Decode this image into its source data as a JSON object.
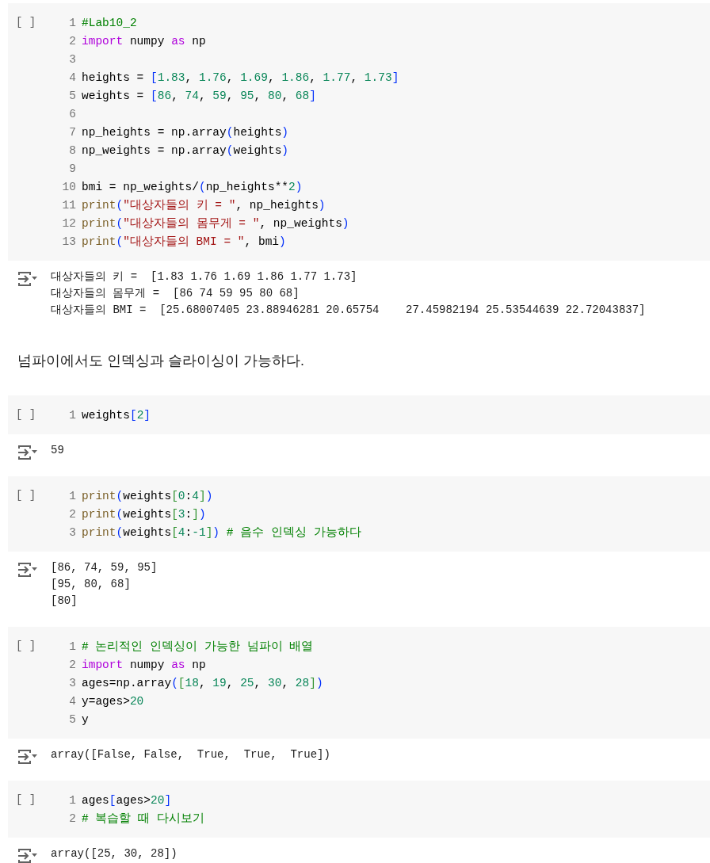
{
  "cells": [
    {
      "kind": "code",
      "run_marker": "[ ]",
      "lines": [
        {
          "number": "1",
          "tokens": [
            {
              "kind": "comment",
              "text": "#Lab10_2"
            }
          ]
        },
        {
          "number": "2",
          "tokens": [
            {
              "kind": "keyword",
              "text": "import"
            },
            {
              "kind": "plain",
              "text": " numpy "
            },
            {
              "kind": "keyword",
              "text": "as"
            },
            {
              "kind": "plain",
              "text": " np"
            }
          ]
        },
        {
          "number": "3"
        },
        {
          "number": "4",
          "tokens": [
            {
              "kind": "plain",
              "text": "heights = "
            },
            {
              "kind": "bracket1",
              "text": "["
            },
            {
              "kind": "number",
              "text": "1.83"
            },
            {
              "kind": "plain",
              "text": ", "
            },
            {
              "kind": "number",
              "text": "1.76"
            },
            {
              "kind": "plain",
              "text": ", "
            },
            {
              "kind": "number",
              "text": "1.69"
            },
            {
              "kind": "plain",
              "text": ", "
            },
            {
              "kind": "number",
              "text": "1.86"
            },
            {
              "kind": "plain",
              "text": ", "
            },
            {
              "kind": "number",
              "text": "1.77"
            },
            {
              "kind": "plain",
              "text": ", "
            },
            {
              "kind": "number",
              "text": "1.73"
            },
            {
              "kind": "bracket1",
              "text": "]"
            }
          ]
        },
        {
          "number": "5",
          "tokens": [
            {
              "kind": "plain",
              "text": "weights = "
            },
            {
              "kind": "bracket1",
              "text": "["
            },
            {
              "kind": "number",
              "text": "86"
            },
            {
              "kind": "plain",
              "text": ", "
            },
            {
              "kind": "number",
              "text": "74"
            },
            {
              "kind": "plain",
              "text": ", "
            },
            {
              "kind": "number",
              "text": "59"
            },
            {
              "kind": "plain",
              "text": ", "
            },
            {
              "kind": "number",
              "text": "95"
            },
            {
              "kind": "plain",
              "text": ", "
            },
            {
              "kind": "number",
              "text": "80"
            },
            {
              "kind": "plain",
              "text": ", "
            },
            {
              "kind": "number",
              "text": "68"
            },
            {
              "kind": "bracket1",
              "text": "]"
            }
          ]
        },
        {
          "number": "6"
        },
        {
          "number": "7",
          "tokens": [
            {
              "kind": "plain",
              "text": "np_heights = np.array"
            },
            {
              "kind": "bracket1",
              "text": "("
            },
            {
              "kind": "plain",
              "text": "heights"
            },
            {
              "kind": "bracket1",
              "text": ")"
            }
          ]
        },
        {
          "number": "8",
          "tokens": [
            {
              "kind": "plain",
              "text": "np_weights = np.array"
            },
            {
              "kind": "bracket1",
              "text": "("
            },
            {
              "kind": "plain",
              "text": "weights"
            },
            {
              "kind": "bracket1",
              "text": ")"
            }
          ]
        },
        {
          "number": "9"
        },
        {
          "number": "10",
          "tokens": [
            {
              "kind": "plain",
              "text": "bmi = np_weights/"
            },
            {
              "kind": "bracket1",
              "text": "("
            },
            {
              "kind": "plain",
              "text": "np_heights**"
            },
            {
              "kind": "number",
              "text": "2"
            },
            {
              "kind": "bracket1",
              "text": ")"
            }
          ]
        },
        {
          "number": "11",
          "tokens": [
            {
              "kind": "function",
              "text": "print"
            },
            {
              "kind": "bracket1",
              "text": "("
            },
            {
              "kind": "string",
              "text": "\"대상자들의 키 = \""
            },
            {
              "kind": "plain",
              "text": ", np_heights"
            },
            {
              "kind": "bracket1",
              "text": ")"
            }
          ]
        },
        {
          "number": "12",
          "tokens": [
            {
              "kind": "function",
              "text": "print"
            },
            {
              "kind": "bracket1",
              "text": "("
            },
            {
              "kind": "string",
              "text": "\"대상자들의 몸무게 = \""
            },
            {
              "kind": "plain",
              "text": ", np_weights"
            },
            {
              "kind": "bracket1",
              "text": ")"
            }
          ]
        },
        {
          "number": "13",
          "tokens": [
            {
              "kind": "function",
              "text": "print"
            },
            {
              "kind": "bracket1",
              "text": "("
            },
            {
              "kind": "string",
              "text": "\"대상자들의 BMI = \""
            },
            {
              "kind": "plain",
              "text": ", bmi"
            },
            {
              "kind": "bracket1",
              "text": ")"
            }
          ]
        }
      ],
      "output": [
        "대상자들의 키 =  [1.83 1.76 1.69 1.86 1.77 1.73]",
        "대상자들의 몸무게 =  [86 74 59 95 80 68]",
        "대상자들의 BMI =  [25.68007405 23.88946281 20.65754    27.45982194 25.53544639 22.72043837]"
      ]
    },
    {
      "kind": "text",
      "text": "넘파이에서도 인덱싱과 슬라이싱이 가능하다."
    },
    {
      "kind": "code",
      "run_marker": "[ ]",
      "lines": [
        {
          "number": "1",
          "tokens": [
            {
              "kind": "plain",
              "text": "weights"
            },
            {
              "kind": "bracket1",
              "text": "["
            },
            {
              "kind": "number",
              "text": "2"
            },
            {
              "kind": "bracket1",
              "text": "]"
            }
          ]
        }
      ],
      "output": [
        "59"
      ]
    },
    {
      "kind": "code",
      "run_marker": "[ ]",
      "lines": [
        {
          "number": "1",
          "tokens": [
            {
              "kind": "function",
              "text": "print"
            },
            {
              "kind": "bracket1",
              "text": "("
            },
            {
              "kind": "plain",
              "text": "weights"
            },
            {
              "kind": "bracket2",
              "text": "["
            },
            {
              "kind": "number",
              "text": "0"
            },
            {
              "kind": "plain",
              "text": ":"
            },
            {
              "kind": "number",
              "text": "4"
            },
            {
              "kind": "bracket2",
              "text": "]"
            },
            {
              "kind": "bracket1",
              "text": ")"
            }
          ]
        },
        {
          "number": "2",
          "tokens": [
            {
              "kind": "function",
              "text": "print"
            },
            {
              "kind": "bracket1",
              "text": "("
            },
            {
              "kind": "plain",
              "text": "weights"
            },
            {
              "kind": "bracket2",
              "text": "["
            },
            {
              "kind": "number",
              "text": "3"
            },
            {
              "kind": "plain",
              "text": ":"
            },
            {
              "kind": "bracket2",
              "text": "]"
            },
            {
              "kind": "bracket1",
              "text": ")"
            }
          ]
        },
        {
          "number": "3",
          "tokens": [
            {
              "kind": "function",
              "text": "print"
            },
            {
              "kind": "bracket1",
              "text": "("
            },
            {
              "kind": "plain",
              "text": "weights"
            },
            {
              "kind": "bracket2",
              "text": "["
            },
            {
              "kind": "number",
              "text": "4"
            },
            {
              "kind": "plain",
              "text": ":"
            },
            {
              "kind": "number",
              "text": "-1"
            },
            {
              "kind": "bracket2",
              "text": "]"
            },
            {
              "kind": "bracket1",
              "text": ")"
            },
            {
              "kind": "comment",
              "text": " # 음수 인덱싱 가능하다"
            }
          ]
        }
      ],
      "output": [
        "[86, 74, 59, 95]",
        "[95, 80, 68]",
        "[80]"
      ]
    },
    {
      "kind": "code",
      "run_marker": "[ ]",
      "lines": [
        {
          "number": "1",
          "tokens": [
            {
              "kind": "comment",
              "text": "# 논리적인 인덱싱이 가능한 넘파이 배열"
            }
          ]
        },
        {
          "number": "2",
          "tokens": [
            {
              "kind": "keyword",
              "text": "import"
            },
            {
              "kind": "plain",
              "text": " numpy "
            },
            {
              "kind": "keyword",
              "text": "as"
            },
            {
              "kind": "plain",
              "text": " np"
            }
          ]
        },
        {
          "number": "3",
          "tokens": [
            {
              "kind": "plain",
              "text": "ages=np.array"
            },
            {
              "kind": "bracket1",
              "text": "("
            },
            {
              "kind": "bracket2",
              "text": "["
            },
            {
              "kind": "number",
              "text": "18"
            },
            {
              "kind": "plain",
              "text": ", "
            },
            {
              "kind": "number",
              "text": "19"
            },
            {
              "kind": "plain",
              "text": ", "
            },
            {
              "kind": "number",
              "text": "25"
            },
            {
              "kind": "plain",
              "text": ", "
            },
            {
              "kind": "number",
              "text": "30"
            },
            {
              "kind": "plain",
              "text": ", "
            },
            {
              "kind": "number",
              "text": "28"
            },
            {
              "kind": "bracket2",
              "text": "]"
            },
            {
              "kind": "bracket1",
              "text": ")"
            }
          ]
        },
        {
          "number": "4",
          "tokens": [
            {
              "kind": "plain",
              "text": "y=ages>"
            },
            {
              "kind": "number",
              "text": "20"
            }
          ]
        },
        {
          "number": "5",
          "tokens": [
            {
              "kind": "plain",
              "text": "y"
            }
          ]
        }
      ],
      "output": [
        "array([False, False,  True,  True,  True])"
      ]
    },
    {
      "kind": "code",
      "run_marker": "[ ]",
      "lines": [
        {
          "number": "1",
          "tokens": [
            {
              "kind": "plain",
              "text": "ages"
            },
            {
              "kind": "bracket1",
              "text": "["
            },
            {
              "kind": "plain",
              "text": "ages>"
            },
            {
              "kind": "number",
              "text": "20"
            },
            {
              "kind": "bracket1",
              "text": "]"
            }
          ]
        },
        {
          "number": "2",
          "tokens": [
            {
              "kind": "comment",
              "text": "# 복습할 때 다시보기"
            }
          ]
        }
      ],
      "output": [
        "array([25, 30, 28])"
      ]
    }
  ]
}
